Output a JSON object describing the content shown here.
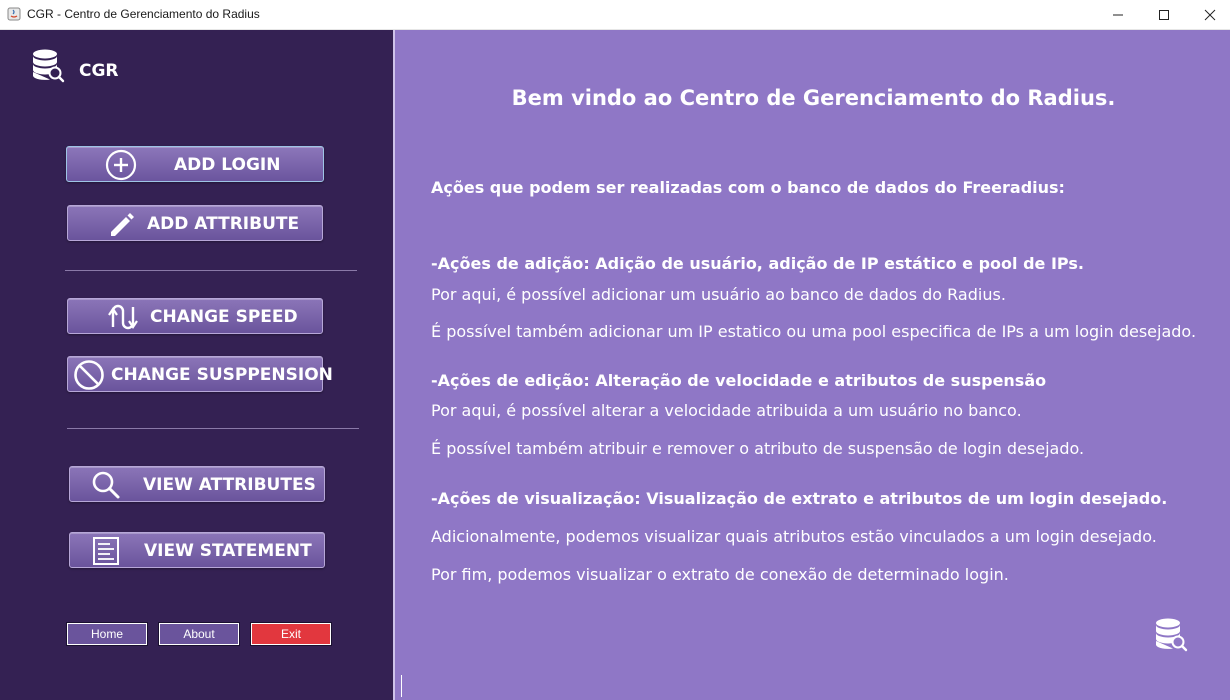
{
  "window": {
    "title": "CGR - Centro de Gerenciamento do Radius",
    "controls": {
      "minimize": "minimize",
      "maximize": "maximize",
      "close": "close"
    }
  },
  "sidebar": {
    "brand": "CGR",
    "buttons": {
      "add_login": "ADD LOGIN",
      "add_attribute": "ADD ATTRIBUTE",
      "change_speed": "CHANGE SPEED",
      "change_suspension": "CHANGE SUSPPENSION",
      "view_attributes": "VIEW ATTRIBUTES",
      "view_statement": "VIEW STATEMENT"
    },
    "footer": {
      "home": "Home",
      "about": "About",
      "exit": "Exit"
    }
  },
  "main": {
    "heading": "Bem vindo ao Centro de Gerenciamento do Radius.",
    "intro": "Ações que podem ser realizadas com o banco de dados do Freeradius:",
    "sections": [
      {
        "title": "-Ações de adição: Adição de usuário, adição de IP estático e pool de IPs.",
        "lines": [
          "Por aqui, é possível adicionar um usuário ao banco de dados do Radius.",
          "É possível também adicionar um IP estatico ou uma pool especifica de IPs a um login desejado."
        ]
      },
      {
        "title": "-Ações de edição: Alteração de velocidade e atributos de suspensão",
        "lines": [
          "Por aqui, é possível alterar a velocidade atribuida a um usuário no banco.",
          "É possível também atribuir e remover o atributo de suspensão de login desejado."
        ]
      },
      {
        "title": "-Ações de visualização: Visualização de extrato e atributos de um login desejado.",
        "lines": [
          "Adicionalmente, podemos visualizar quais atributos estão vinculados a um login desejado.",
          "Por fim, podemos visualizar o extrato de conexão de determinado login."
        ]
      }
    ]
  },
  "colors": {
    "sidebar_bg": "#342153",
    "content_bg": "#8f77c6",
    "button_bg": "#7a64ab",
    "exit_bg": "#e2373e"
  },
  "icons": [
    "java-app-icon",
    "database-search-icon",
    "plus-circle-icon",
    "pencil-icon",
    "speed-arrows-icon",
    "prohibited-icon",
    "magnifier-icon",
    "document-icon"
  ]
}
